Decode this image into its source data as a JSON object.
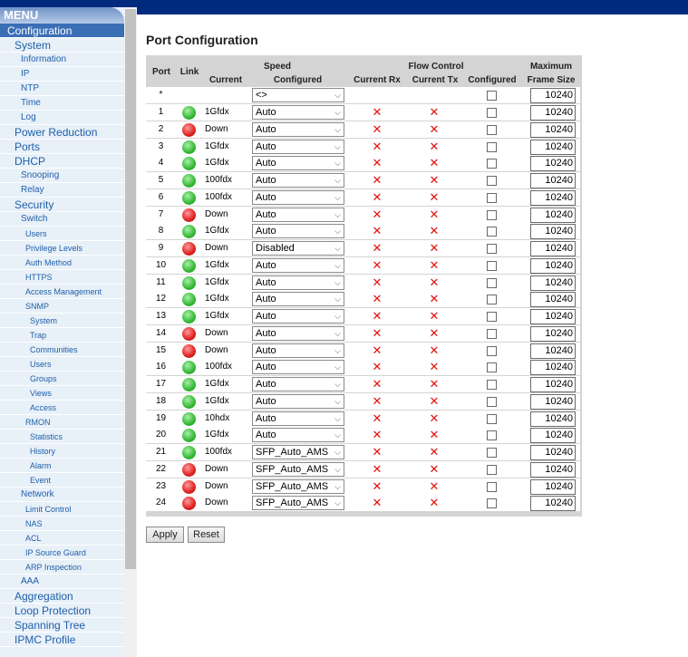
{
  "menu": {
    "header": "MENU",
    "items": [
      {
        "label": "Configuration",
        "level": 0,
        "selected": true
      },
      {
        "label": "System",
        "level": 0
      },
      {
        "label": "Information",
        "level": 1
      },
      {
        "label": "IP",
        "level": 1
      },
      {
        "label": "NTP",
        "level": 1
      },
      {
        "label": "Time",
        "level": 1
      },
      {
        "label": "Log",
        "level": 1
      },
      {
        "label": "Power Reduction",
        "level": 0
      },
      {
        "label": "Ports",
        "level": 0
      },
      {
        "label": "DHCP",
        "level": 0
      },
      {
        "label": "Snooping",
        "level": 1
      },
      {
        "label": "Relay",
        "level": 1
      },
      {
        "label": "Security",
        "level": 0
      },
      {
        "label": "Switch",
        "level": 1
      },
      {
        "label": "Users",
        "level": 2
      },
      {
        "label": "Privilege Levels",
        "level": 2
      },
      {
        "label": "Auth Method",
        "level": 2
      },
      {
        "label": "HTTPS",
        "level": 2
      },
      {
        "label": "Access Management",
        "level": 2
      },
      {
        "label": "SNMP",
        "level": 2
      },
      {
        "label": "System",
        "level": 3
      },
      {
        "label": "Trap",
        "level": 3
      },
      {
        "label": "Communities",
        "level": 3
      },
      {
        "label": "Users",
        "level": 3
      },
      {
        "label": "Groups",
        "level": 3
      },
      {
        "label": "Views",
        "level": 3
      },
      {
        "label": "Access",
        "level": 3
      },
      {
        "label": "RMON",
        "level": 2
      },
      {
        "label": "Statistics",
        "level": 3
      },
      {
        "label": "History",
        "level": 3
      },
      {
        "label": "Alarm",
        "level": 3
      },
      {
        "label": "Event",
        "level": 3
      },
      {
        "label": "Network",
        "level": 1
      },
      {
        "label": "Limit Control",
        "level": 2
      },
      {
        "label": "NAS",
        "level": 2
      },
      {
        "label": "ACL",
        "level": 2
      },
      {
        "label": "IP Source Guard",
        "level": 2
      },
      {
        "label": "ARP Inspection",
        "level": 2
      },
      {
        "label": "AAA",
        "level": 1
      },
      {
        "label": "Aggregation",
        "level": 0
      },
      {
        "label": "Loop Protection",
        "level": 0
      },
      {
        "label": "Spanning Tree",
        "level": 0
      },
      {
        "label": "IPMC Profile",
        "level": 0
      }
    ]
  },
  "page": {
    "title": "Port Configuration"
  },
  "table": {
    "headers": {
      "port": "Port",
      "link": "Link",
      "speed": "Speed",
      "speed_current": "Current",
      "speed_configured": "Configured",
      "flow_control": "Flow Control",
      "current_rx": "Current Rx",
      "current_tx": "Current Tx",
      "fc_configured": "Configured",
      "maximum": "Maximum",
      "frame_size": "Frame Size"
    },
    "all_row": {
      "port": "*",
      "configured": "<>",
      "max_frame": "10240"
    },
    "rows": [
      {
        "port": "1",
        "link": "up",
        "current": "1Gfdx",
        "configured": "Auto",
        "max_frame": "10240"
      },
      {
        "port": "2",
        "link": "down",
        "current": "Down",
        "configured": "Auto",
        "max_frame": "10240"
      },
      {
        "port": "3",
        "link": "up",
        "current": "1Gfdx",
        "configured": "Auto",
        "max_frame": "10240"
      },
      {
        "port": "4",
        "link": "up",
        "current": "1Gfdx",
        "configured": "Auto",
        "max_frame": "10240"
      },
      {
        "port": "5",
        "link": "up",
        "current": "100fdx",
        "configured": "Auto",
        "max_frame": "10240"
      },
      {
        "port": "6",
        "link": "up",
        "current": "100fdx",
        "configured": "Auto",
        "max_frame": "10240"
      },
      {
        "port": "7",
        "link": "down",
        "current": "Down",
        "configured": "Auto",
        "max_frame": "10240"
      },
      {
        "port": "8",
        "link": "up",
        "current": "1Gfdx",
        "configured": "Auto",
        "max_frame": "10240"
      },
      {
        "port": "9",
        "link": "down",
        "current": "Down",
        "configured": "Disabled",
        "max_frame": "10240"
      },
      {
        "port": "10",
        "link": "up",
        "current": "1Gfdx",
        "configured": "Auto",
        "max_frame": "10240"
      },
      {
        "port": "11",
        "link": "up",
        "current": "1Gfdx",
        "configured": "Auto",
        "max_frame": "10240"
      },
      {
        "port": "12",
        "link": "up",
        "current": "1Gfdx",
        "configured": "Auto",
        "max_frame": "10240"
      },
      {
        "port": "13",
        "link": "up",
        "current": "1Gfdx",
        "configured": "Auto",
        "max_frame": "10240"
      },
      {
        "port": "14",
        "link": "down",
        "current": "Down",
        "configured": "Auto",
        "max_frame": "10240"
      },
      {
        "port": "15",
        "link": "down",
        "current": "Down",
        "configured": "Auto",
        "max_frame": "10240"
      },
      {
        "port": "16",
        "link": "up",
        "current": "100fdx",
        "configured": "Auto",
        "max_frame": "10240"
      },
      {
        "port": "17",
        "link": "up",
        "current": "1Gfdx",
        "configured": "Auto",
        "max_frame": "10240"
      },
      {
        "port": "18",
        "link": "up",
        "current": "1Gfdx",
        "configured": "Auto",
        "max_frame": "10240"
      },
      {
        "port": "19",
        "link": "up",
        "current": "10hdx",
        "configured": "Auto",
        "max_frame": "10240"
      },
      {
        "port": "20",
        "link": "up",
        "current": "1Gfdx",
        "configured": "Auto",
        "max_frame": "10240"
      },
      {
        "port": "21",
        "link": "up",
        "current": "100fdx",
        "configured": "SFP_Auto_AMS",
        "max_frame": "10240"
      },
      {
        "port": "22",
        "link": "down",
        "current": "Down",
        "configured": "SFP_Auto_AMS",
        "max_frame": "10240"
      },
      {
        "port": "23",
        "link": "down",
        "current": "Down",
        "configured": "SFP_Auto_AMS",
        "max_frame": "10240"
      },
      {
        "port": "24",
        "link": "down",
        "current": "Down",
        "configured": "SFP_Auto_AMS",
        "max_frame": "10240"
      }
    ]
  },
  "buttons": {
    "apply": "Apply",
    "reset": "Reset"
  },
  "icons": {
    "flow_disabled": "x-mark-icon",
    "link_up": "green-dot-icon",
    "link_down": "red-dot-icon",
    "dropdown": "chevron-down-icon"
  },
  "colors": {
    "link_up": "#33b833",
    "link_down": "#e02020",
    "flow_x": "#e01010",
    "topbar": "#002a7e",
    "menu_text": "#1f5fa9"
  }
}
